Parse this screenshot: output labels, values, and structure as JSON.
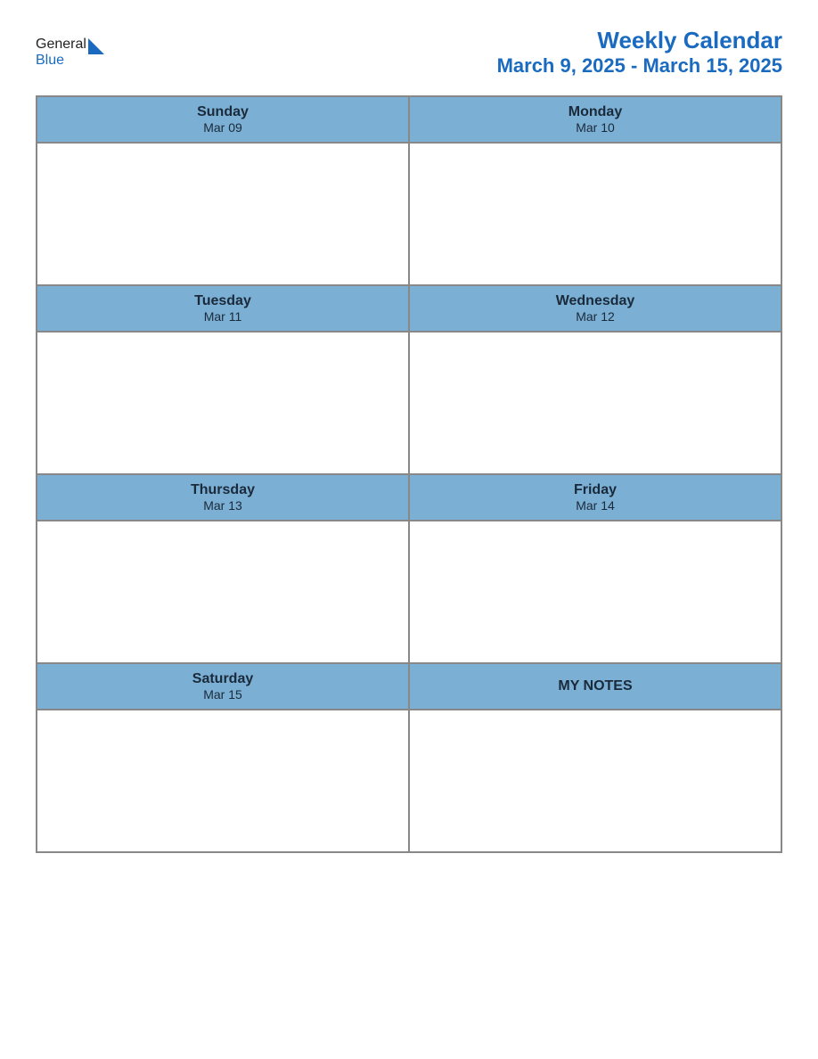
{
  "logo": {
    "general": "General",
    "blue": "Blue"
  },
  "title": {
    "main": "Weekly Calendar",
    "sub": "March 9, 2025 - March 15, 2025"
  },
  "rows": [
    {
      "cells": [
        {
          "name": "Sunday",
          "date": "Mar 09"
        },
        {
          "name": "Monday",
          "date": "Mar 10"
        }
      ]
    },
    {
      "cells": [
        {
          "name": "Tuesday",
          "date": "Mar 11"
        },
        {
          "name": "Wednesday",
          "date": "Mar 12"
        }
      ]
    },
    {
      "cells": [
        {
          "name": "Thursday",
          "date": "Mar 13"
        },
        {
          "name": "Friday",
          "date": "Mar 14"
        }
      ]
    },
    {
      "cells": [
        {
          "name": "Saturday",
          "date": "Mar 15"
        },
        {
          "name": "MY NOTES",
          "date": "",
          "isNotes": true
        }
      ]
    }
  ]
}
